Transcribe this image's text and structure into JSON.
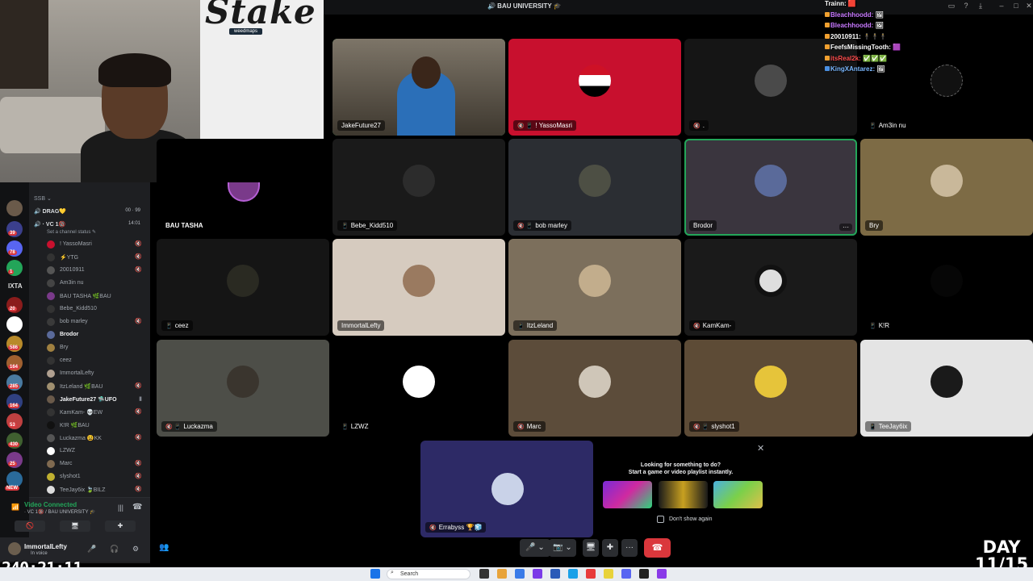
{
  "window": {
    "title": "🔊 BAU UNIVERSITY 🎓"
  },
  "webcam": {
    "brand": "Stake",
    "brand_sub": "weedmaps"
  },
  "sidebar": {
    "category": "SSB ⌄",
    "channels": [
      {
        "name": "🔊 DRAG💛",
        "time": "00 · 99"
      },
      {
        "name": "🔊 · VC 1🔞",
        "time": "14:01"
      }
    ],
    "channel_status": "Set a channel status ✎",
    "members": [
      {
        "name": "! YassoMasri"
      },
      {
        "name": "⚡YTG"
      },
      {
        "name": "20010911"
      },
      {
        "name": "Am3in nu"
      },
      {
        "name": "BAU TASHA 🌿BAU"
      },
      {
        "name": "Bebe_Kidd510"
      },
      {
        "name": "bob marley"
      },
      {
        "name": "Brodor"
      },
      {
        "name": "Bry"
      },
      {
        "name": "ceez"
      },
      {
        "name": "ImmortalLefty"
      },
      {
        "name": "ItzLeland 🌿BAU"
      },
      {
        "name": "JakeFuture27 🛸UFO"
      },
      {
        "name": "KamKam- 💀EW"
      },
      {
        "name": "K!R 🌿BAU"
      },
      {
        "name": "Luckazma 😫KK"
      },
      {
        "name": "LZWZ"
      },
      {
        "name": "Marc"
      },
      {
        "name": "slyshot1"
      },
      {
        "name": "TeeJay6ix 🍃BILZ"
      }
    ],
    "voice": {
      "status": "Video Connected",
      "location": "· VC 1🔞 / BAU UNIVERSITY 🎓"
    },
    "user": {
      "name": "ImmortalLefty",
      "status": "In voice"
    }
  },
  "rail": {
    "badges": [
      "39",
      "78",
      "1",
      "20",
      "586",
      "164",
      "285",
      "164",
      "53",
      "430",
      "25"
    ],
    "tag": "IXTA",
    "new_label": "NEW"
  },
  "grid": [
    {
      "name": "JakeFuture27",
      "bg": "#4a4236",
      "selected": true
    },
    {
      "name": "! YassoMasri",
      "bg": "#c8102e",
      "icons": "🔇 📱"
    },
    {
      "name": ".",
      "bg": "#151515",
      "icons": "🔇"
    },
    {
      "name": "Am3in nu",
      "bg": "#000000",
      "icons": "📱"
    },
    {
      "name": "BAU TASHA",
      "bg": "#000000"
    },
    {
      "name": "Bebe_Kidd510",
      "bg": "#1a1a1a",
      "icons": "📱"
    },
    {
      "name": "bob marley",
      "bg": "#2b2e33",
      "icons": "🔇 📱"
    },
    {
      "name": "Brodor",
      "bg": "#3a353e",
      "selected": true
    },
    {
      "name": "Bry",
      "bg": "#7d6b45"
    },
    {
      "name": "ceez",
      "bg": "#151515",
      "icons": "📱"
    },
    {
      "name": "ImmortalLefty",
      "bg": "#d6cbbf"
    },
    {
      "name": "ItzLeland",
      "bg": "#7c6f5c",
      "icons": "📱"
    },
    {
      "name": "KamKam-",
      "bg": "#1a1a1a",
      "icons": "🔇"
    },
    {
      "name": "K!R",
      "bg": "#000000",
      "icons": "📱"
    },
    {
      "name": "Luckazma",
      "bg": "#4d4e48",
      "icons": "🔇 📱"
    },
    {
      "name": "LZWZ",
      "bg": "#000000",
      "icons": "📱"
    },
    {
      "name": "Marc",
      "bg": "#5c4c3a",
      "icons": "🔇"
    },
    {
      "name": "slyshot1",
      "bg": "#5d4b36",
      "icons": "🔇 📱"
    },
    {
      "name": "TeeJay6ix",
      "bg": "#e4e4e4",
      "icons": "📱"
    }
  ],
  "self_tile": {
    "name": "Errabyss 🏆🧊"
  },
  "activity": {
    "title_line1": "Looking for something to do?",
    "title_line2": "Start a game or video playlist instantly.",
    "dont_show": "Don't show again"
  },
  "chat": [
    {
      "user": "Trainn:",
      "msg": "🟥",
      "color": "#ff5c5c"
    },
    {
      "user": "Bleachhoodd:",
      "msg": "🖼",
      "color": "#c879ff"
    },
    {
      "user": "Bleachhoodd:",
      "msg": "🖼",
      "color": "#c879ff"
    },
    {
      "user": "20010911:",
      "msg": "🕴🕴🕴",
      "color": "#ffffff"
    },
    {
      "user": "FeefsMissingTooth:",
      "msg": "🟪",
      "color": "#ffffff"
    },
    {
      "user": "itsReal2k:",
      "msg": "✅✅✅",
      "color": "#ff4d4d"
    },
    {
      "user": "KingXAntarez:",
      "msg": "🖼",
      "color": "#7ab8ff"
    }
  ],
  "overlay": {
    "timer": "240:21:11",
    "day_line1": "DAY",
    "day_line2": "11/15"
  },
  "taskbar": {
    "search": "Search"
  }
}
